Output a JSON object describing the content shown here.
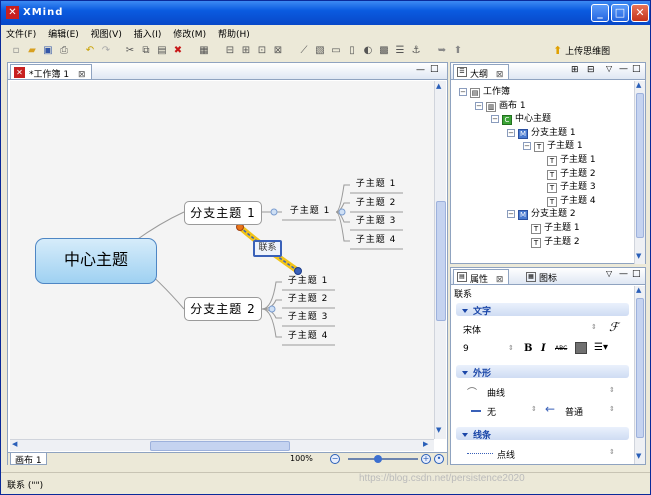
{
  "app": {
    "title": "XMind",
    "menus": [
      "文件(F)",
      "编辑(E)",
      "视图(V)",
      "插入(I)",
      "修改(M)",
      "帮助(H)"
    ]
  },
  "toolbar": {
    "upload_label": "上传思维图"
  },
  "editor": {
    "tab_label": "*工作簿 1",
    "sheet_tab": "画布 1",
    "zoom": "100%"
  },
  "map": {
    "central": "中心主题",
    "main1": "分支主题 1",
    "main2": "分支主题 2",
    "main1_sub": "子主题 1",
    "main1_children": [
      "子主题 1",
      "子主题 2",
      "子主题 3",
      "子主题 4"
    ],
    "main2_children": [
      "子主题 1",
      "子主题 2",
      "子主题 3",
      "子主题 4"
    ],
    "relationship": "联系"
  },
  "outline": {
    "tab_label": "大纲",
    "tree": [
      {
        "label": "工作簿",
        "icon": "workbook-icon",
        "glyph": "▤"
      },
      {
        "label": "画布 1",
        "icon": "sheet-icon",
        "glyph": "▥"
      },
      {
        "label": "中心主题",
        "icon": "central-topic-icon",
        "glyph": "C"
      },
      {
        "label": "分支主题 1",
        "icon": "main-topic-icon",
        "glyph": "M"
      },
      {
        "label": "子主题 1",
        "icon": "topic-icon",
        "glyph": "T"
      },
      {
        "label": "子主题 1",
        "icon": "topic-icon",
        "glyph": "T"
      },
      {
        "label": "子主题 2",
        "icon": "topic-icon",
        "glyph": "T"
      },
      {
        "label": "子主题 3",
        "icon": "topic-icon",
        "glyph": "T"
      },
      {
        "label": "子主题 4",
        "icon": "topic-icon",
        "glyph": "T"
      },
      {
        "label": "分支主题 2",
        "icon": "main-topic-icon",
        "glyph": "M"
      },
      {
        "label": "子主题 1",
        "icon": "topic-icon",
        "glyph": "T"
      },
      {
        "label": "子主题 2",
        "icon": "topic-icon",
        "glyph": "T"
      }
    ]
  },
  "properties": {
    "tab_label": "属性",
    "tab2_label": "图标",
    "selection": "联系",
    "text_section": "文字",
    "font": "宋体",
    "font_size": "9",
    "shape_section": "外形",
    "curve": "曲线",
    "start_arrow": "无",
    "end_arrow": "普通",
    "line_section": "线条",
    "line_style": "点线"
  },
  "status": {
    "text": "联系 (\"\")"
  },
  "watermark": "https://blog.csdn.net/persistence2020"
}
